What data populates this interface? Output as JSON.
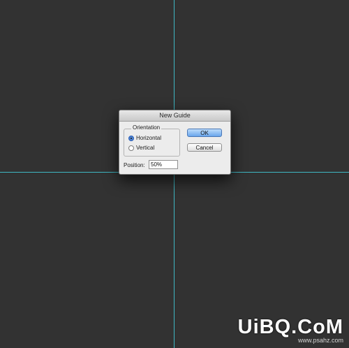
{
  "dialog": {
    "title": "New Guide",
    "orientation": {
      "label": "Orientation",
      "options": [
        {
          "label": "Horizontal",
          "checked": true
        },
        {
          "label": "Vertical",
          "checked": false
        }
      ]
    },
    "ok_label": "OK",
    "cancel_label": "Cancel",
    "position": {
      "label": "Position:",
      "value": "50%"
    }
  },
  "watermark": {
    "main": "UiBQ.CoM",
    "sub": "www.psahz.com"
  },
  "colors": {
    "canvas": "#323232",
    "guide": "#3fb8c4",
    "ok_button": "#6aa6ec"
  }
}
